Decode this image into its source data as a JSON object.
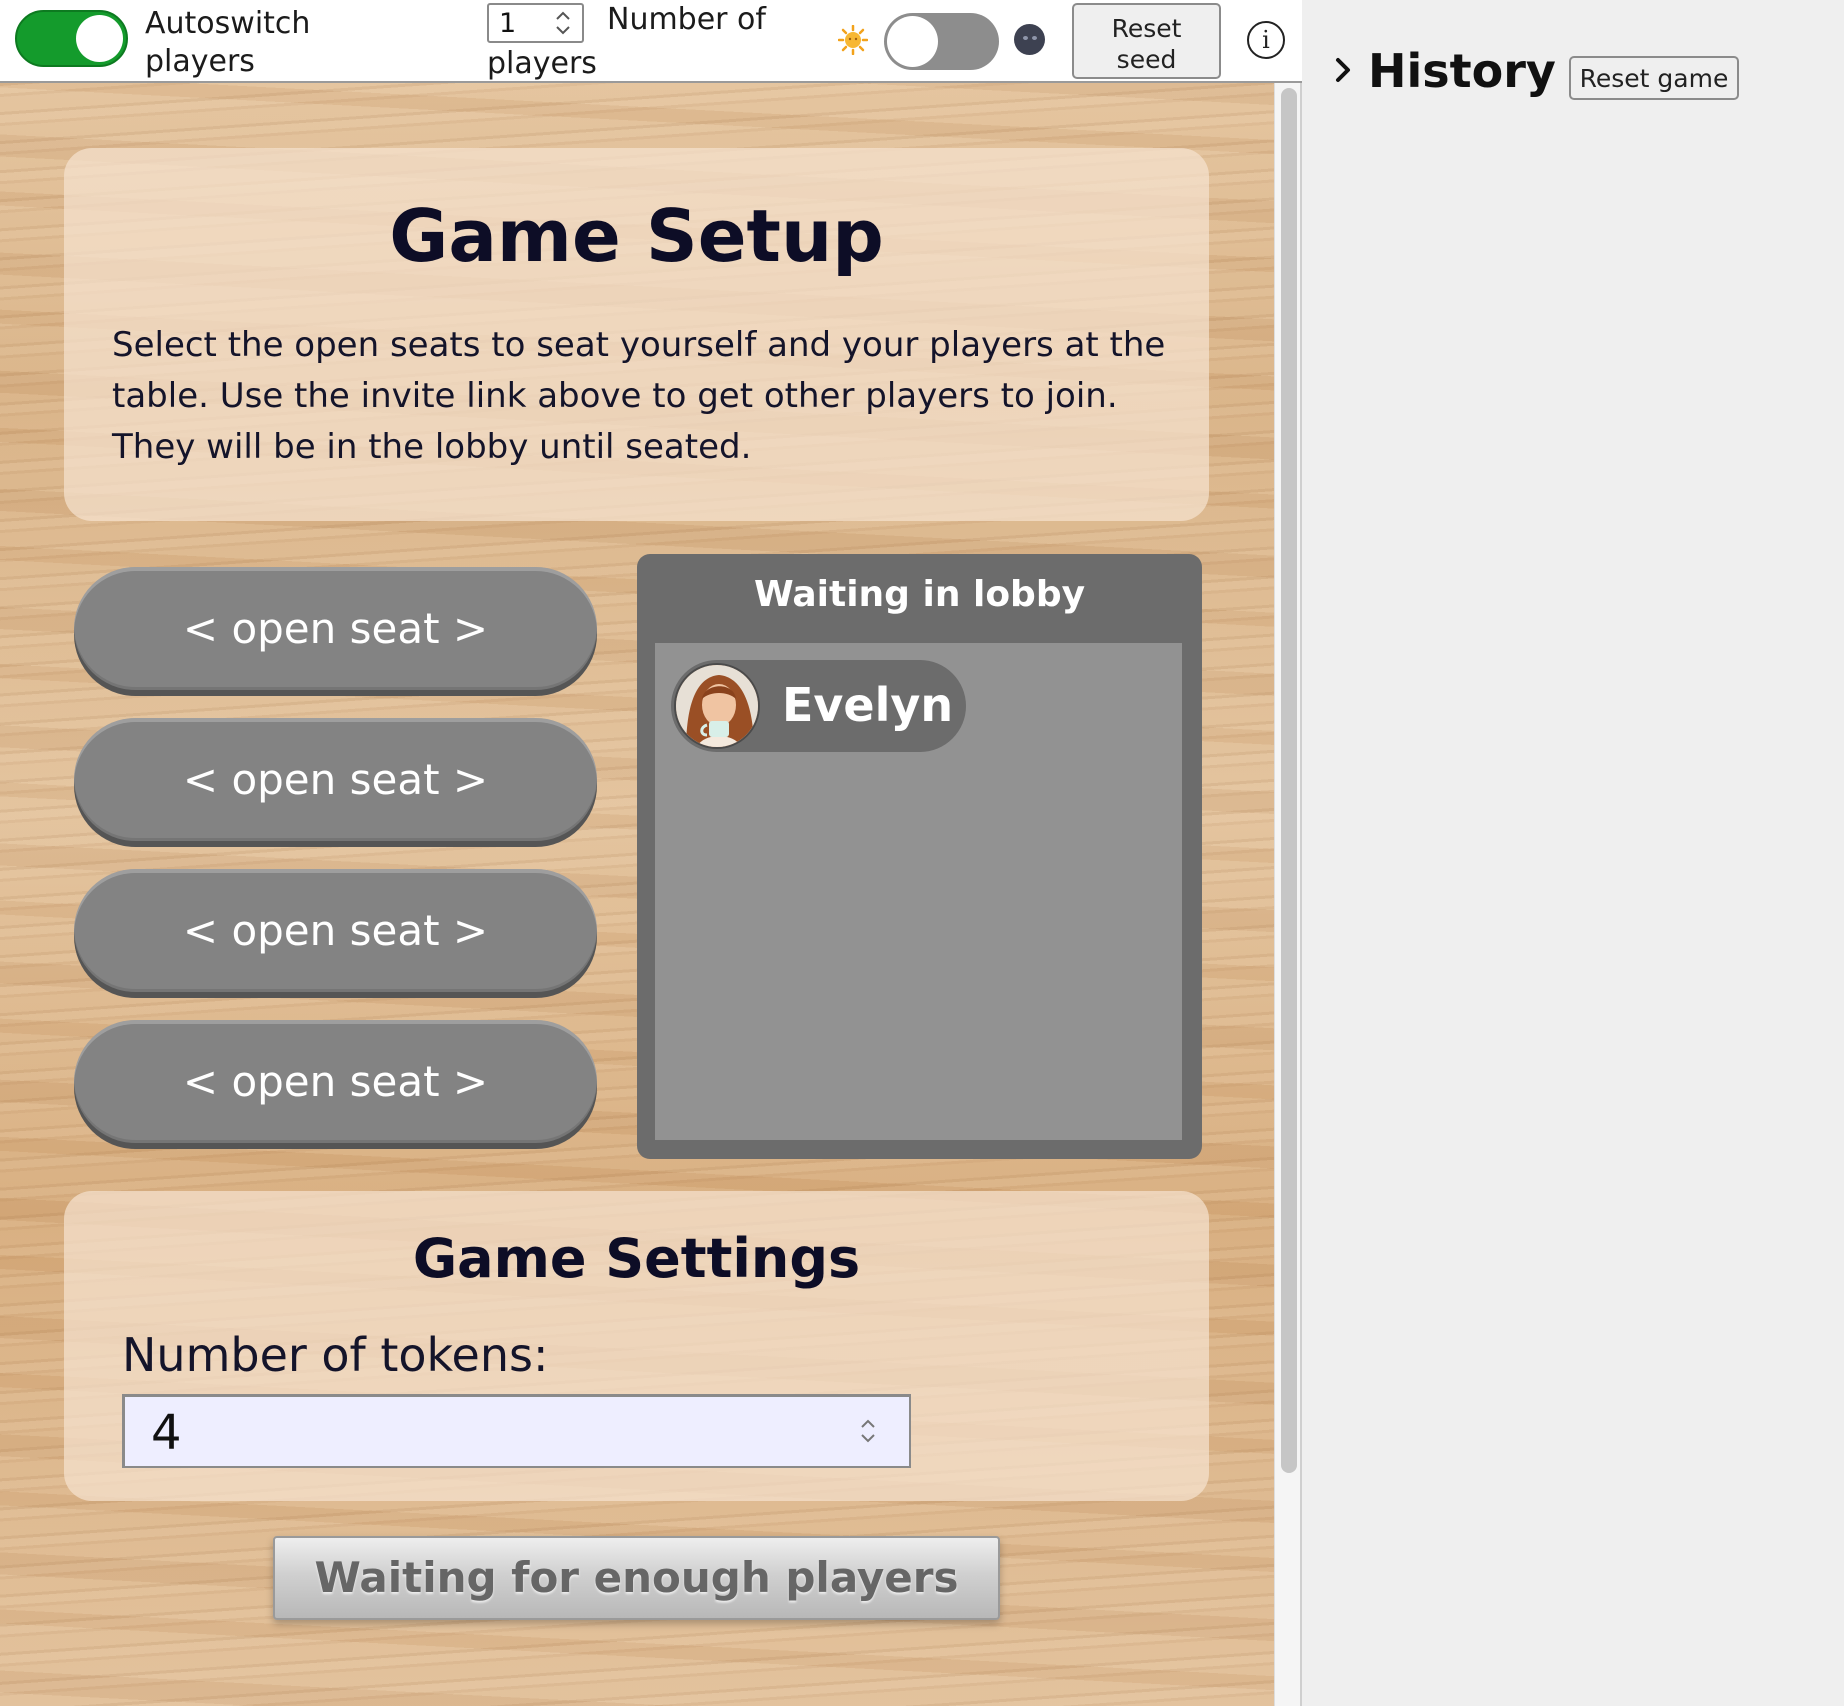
{
  "toolbar": {
    "autoswitch": {
      "label": "Autoswitch players",
      "on": true
    },
    "num_players": {
      "value": "1",
      "label": "Number of players",
      "label_line1": "Number of",
      "label_line2": "players"
    },
    "theme_toggle": {
      "mode": "light",
      "light_icon": "sun-icon",
      "dark_icon": "moon-icon"
    },
    "reset_seed_label": "Reset\nseed",
    "info_icon": "info-icon",
    "info_glyph": "i"
  },
  "setup": {
    "title": "Game Setup",
    "description": "Select the open seats to seat yourself and your players at the table. Use the invite link above to get other players to join. They will be in the lobby until seated."
  },
  "seats": [
    {
      "label": "< open seat >"
    },
    {
      "label": "< open seat >"
    },
    {
      "label": "< open seat >"
    },
    {
      "label": "< open seat >"
    }
  ],
  "lobby": {
    "title": "Waiting in lobby",
    "players": [
      {
        "name": "Evelyn",
        "avatar": "avatar-photo"
      }
    ]
  },
  "settings": {
    "title": "Game Settings",
    "tokens_label": "Number of tokens:",
    "tokens_value": "4"
  },
  "start_button_label": "Waiting for enough players",
  "history": {
    "title": "History",
    "reset_game_label": "Reset game",
    "expander_icon": "chevron-right-icon"
  },
  "colors": {
    "toggle_on": "#149b2c",
    "seat": "#838383",
    "lobby": "#6c6c6c",
    "lobby_body": "#929292",
    "heading_text": "#0d0d26"
  }
}
